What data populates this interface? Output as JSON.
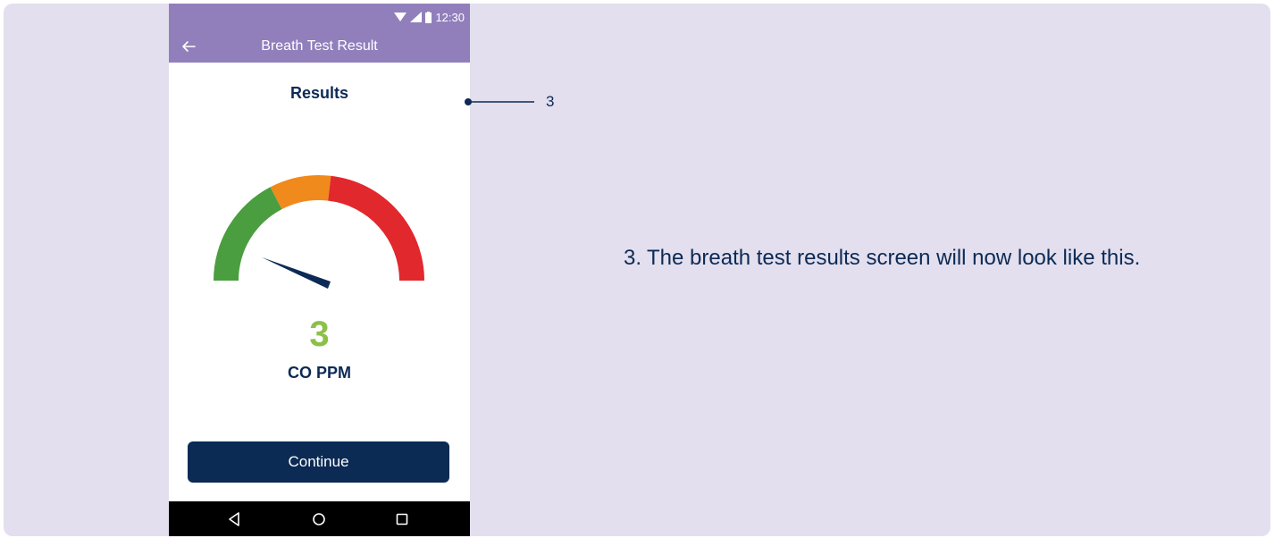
{
  "status_bar": {
    "time": "12:30",
    "icons": [
      "wifi-icon",
      "signal-icon",
      "battery-icon"
    ]
  },
  "app_bar": {
    "title": "Breath Test Result",
    "back_icon": "back-arrow-icon"
  },
  "results": {
    "heading": "Results",
    "value": "3",
    "unit": "CO PPM",
    "gauge_zones": [
      {
        "name": "green",
        "color": "#4a9e3f"
      },
      {
        "name": "orange",
        "color": "#f08a1c"
      },
      {
        "name": "red",
        "color": "#e1282d"
      }
    ],
    "value_color": "#8cc04a"
  },
  "continue_label": "Continue",
  "nav_bar": {
    "icons": [
      "back-triangle-icon",
      "home-circle-icon",
      "recents-square-icon"
    ]
  },
  "callout": {
    "label": "3"
  },
  "instruction": {
    "number": "3.",
    "text": "The breath test results screen will now look like this."
  },
  "colors": {
    "panel": "#e3dfee",
    "header": "#917fbc",
    "navy": "#0b2a54"
  }
}
